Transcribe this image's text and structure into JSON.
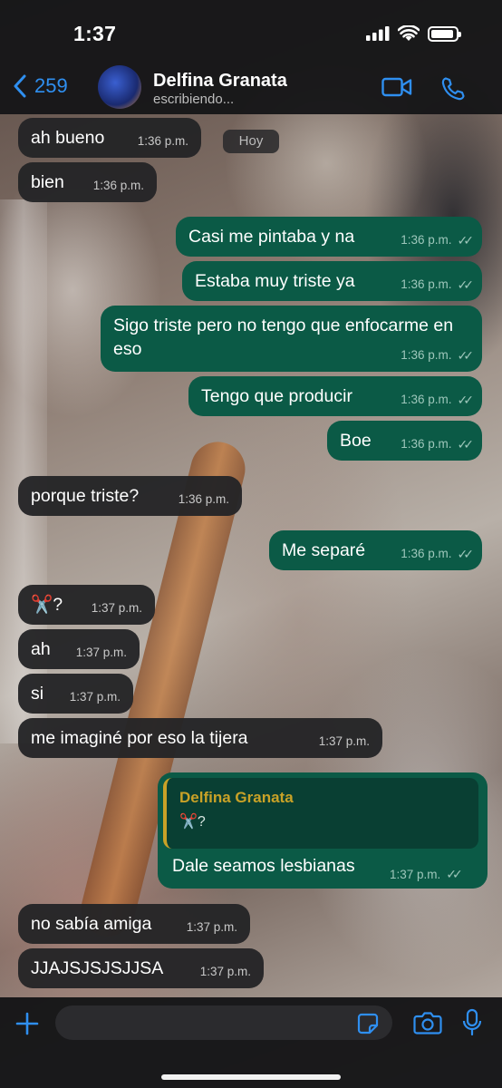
{
  "status": {
    "time": "1:37"
  },
  "header": {
    "back_count": "259",
    "contact_name": "Delfina Granata",
    "contact_status": "escribiendo..."
  },
  "date_chip": "Hoy",
  "messages": [
    {
      "dir": "in",
      "text": "ah bueno",
      "time": "1:36 p.m."
    },
    {
      "dir": "in",
      "text": "bien",
      "time": "1:36 p.m."
    },
    {
      "dir": "out",
      "text": "Casi me pintaba y na",
      "time": "1:36 p.m."
    },
    {
      "dir": "out",
      "text": "Estaba muy triste ya",
      "time": "1:36 p.m."
    },
    {
      "dir": "out",
      "text": "Sigo triste pero no tengo que enfocarme en eso",
      "time": "1:36 p.m."
    },
    {
      "dir": "out",
      "text": "Tengo que producir",
      "time": "1:36 p.m."
    },
    {
      "dir": "out",
      "text": "Boe",
      "time": "1:36 p.m."
    },
    {
      "dir": "in",
      "text": "porque triste?",
      "time": "1:36 p.m."
    },
    {
      "dir": "out",
      "text": "Me separé",
      "time": "1:36 p.m."
    },
    {
      "dir": "in",
      "text": "✂️?",
      "time": "1:37 p.m."
    },
    {
      "dir": "in",
      "text": "ah",
      "time": "1:37 p.m."
    },
    {
      "dir": "in",
      "text": "si",
      "time": "1:37 p.m."
    },
    {
      "dir": "in",
      "text": "me imaginé por eso la tijera",
      "time": "1:37 p.m."
    },
    {
      "dir": "out",
      "text": "Dale seamos lesbianas",
      "time": "1:37 p.m.",
      "quote": {
        "author": "Delfina Granata",
        "text": "✂️?"
      }
    },
    {
      "dir": "in",
      "text": "no sabía amiga",
      "time": "1:37 p.m."
    },
    {
      "dir": "in",
      "text": "JJAJSJSJSJJSA",
      "time": "1:37 p.m."
    }
  ],
  "colors": {
    "accent": "#2f8ff0",
    "outgoing": "#0b5a46",
    "incoming": "#242426",
    "quote_author": "#c9a227"
  },
  "icons": [
    "back-chevron-icon",
    "video-call-icon",
    "phone-icon",
    "plus-icon",
    "sticker-icon",
    "camera-icon",
    "microphone-icon",
    "signal-icon",
    "wifi-icon",
    "battery-icon",
    "double-check-icon"
  ]
}
